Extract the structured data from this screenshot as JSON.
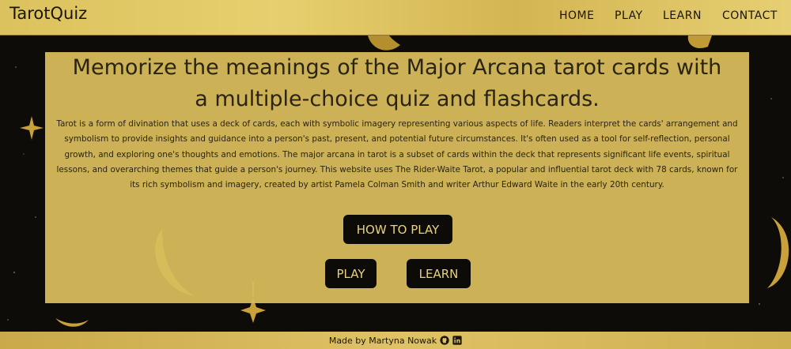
{
  "header": {
    "brand": "TarotQuiz",
    "nav": [
      "HOME",
      "PLAY",
      "LEARN",
      "CONTACT"
    ]
  },
  "main": {
    "title_line1": "Memorize the meanings of the Major Arcana tarot cards with",
    "title_line2": "a multiple-choice quiz and flashcards.",
    "description": "Tarot is a form of divination that uses a deck of cards, each with symbolic imagery representing various aspects of life. Readers interpret the cards' arrangement and symbolism to provide insights and guidance into a person's past, present, and potential future circumstances. It's often used as a tool for self-reflection, personal growth, and exploring one's thoughts and emotions. The major arcana in tarot is a subset of cards within the deck that represents significant life events, spiritual lessons, and overarching themes that guide a person's journey. This website uses The Rider-Waite Tarot, a popular and influential tarot deck with 78 cards, known for its rich symbolism and imagery, created by artist Pamela Colman Smith and writer Arthur Edward Waite in the early 20th century.",
    "how_to_play_label": "HOW TO PLAY",
    "play_label": "PLAY",
    "learn_label": "LEARN"
  },
  "footer": {
    "credit": "Made by Martyna Nowak",
    "icons": [
      "github-icon",
      "linkedin-icon"
    ]
  },
  "colors": {
    "gold": "#dcc25e",
    "panel": "#dabe5c",
    "button_bg": "#0d0b07",
    "button_text": "#e9d27a",
    "text": "#1b1508"
  }
}
